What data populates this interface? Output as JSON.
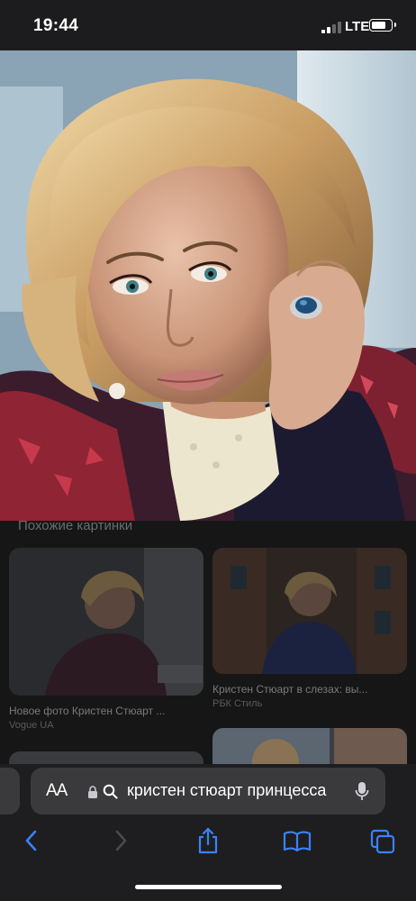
{
  "status_bar": {
    "time": "19:44",
    "network": "LTE"
  },
  "hero_image": {
    "subject": "woman-portrait-photo"
  },
  "similar": {
    "section_title": "Похожие картинки",
    "cards": [
      {
        "title": "Новое фото Кристен Стюарт ...",
        "source": "Vogue UA"
      },
      {
        "title": "Кристен Стюарт в слезах: вы...",
        "source": "РБК Стиль"
      }
    ]
  },
  "address_bar": {
    "text_size_label": "AA",
    "query": "кристен стюарт принцесса"
  },
  "toolbar": {
    "icons": [
      "back-icon",
      "forward-icon",
      "share-icon",
      "bookmarks-icon",
      "tabs-icon"
    ],
    "accent_color": "#3b82f6",
    "disabled_color": "#4a4a4e"
  }
}
